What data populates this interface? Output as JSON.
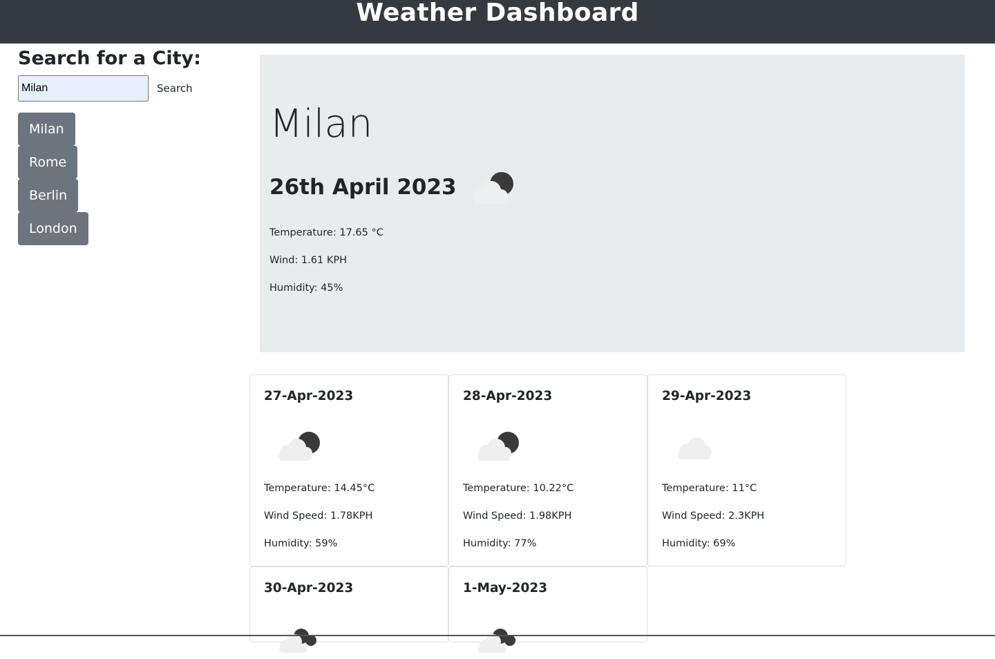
{
  "header": {
    "title": "Weather Dashboard"
  },
  "search": {
    "heading": "Search for a City:",
    "input_value": "Milan",
    "button_label": "Search"
  },
  "history": [
    {
      "label": "Milan"
    },
    {
      "label": "Rome"
    },
    {
      "label": "Berlin"
    },
    {
      "label": "London"
    }
  ],
  "current": {
    "city": "Milan",
    "date": "26th April 2023",
    "icon": "night-cloudy-icon",
    "temperature": "Temperature: 17.65 °C",
    "wind": "Wind: 1.61 KPH",
    "humidity": "Humidity: 45%"
  },
  "forecast": [
    {
      "date": "27-Apr-2023",
      "icon": "night-cloudy-icon",
      "temperature": "Temperature: 14.45°C",
      "wind": "Wind Speed: 1.78KPH",
      "humidity": "Humidity: 59%"
    },
    {
      "date": "28-Apr-2023",
      "icon": "night-cloudy-icon",
      "temperature": "Temperature: 10.22°C",
      "wind": "Wind Speed: 1.98KPH",
      "humidity": "Humidity: 77%"
    },
    {
      "date": "29-Apr-2023",
      "icon": "cloud-icon",
      "temperature": "Temperature: 11°C",
      "wind": "Wind Speed: 2.3KPH",
      "humidity": "Humidity: 69%"
    },
    {
      "date": "30-Apr-2023",
      "icon": "night-broken-clouds-icon"
    },
    {
      "date": "1-May-2023",
      "icon": "night-broken-clouds-icon"
    }
  ],
  "colors": {
    "header_bg": "#343a40",
    "history_button_bg": "#6c757d",
    "hero_bg": "#e9ecef",
    "input_bg": "#e8f0fe"
  }
}
